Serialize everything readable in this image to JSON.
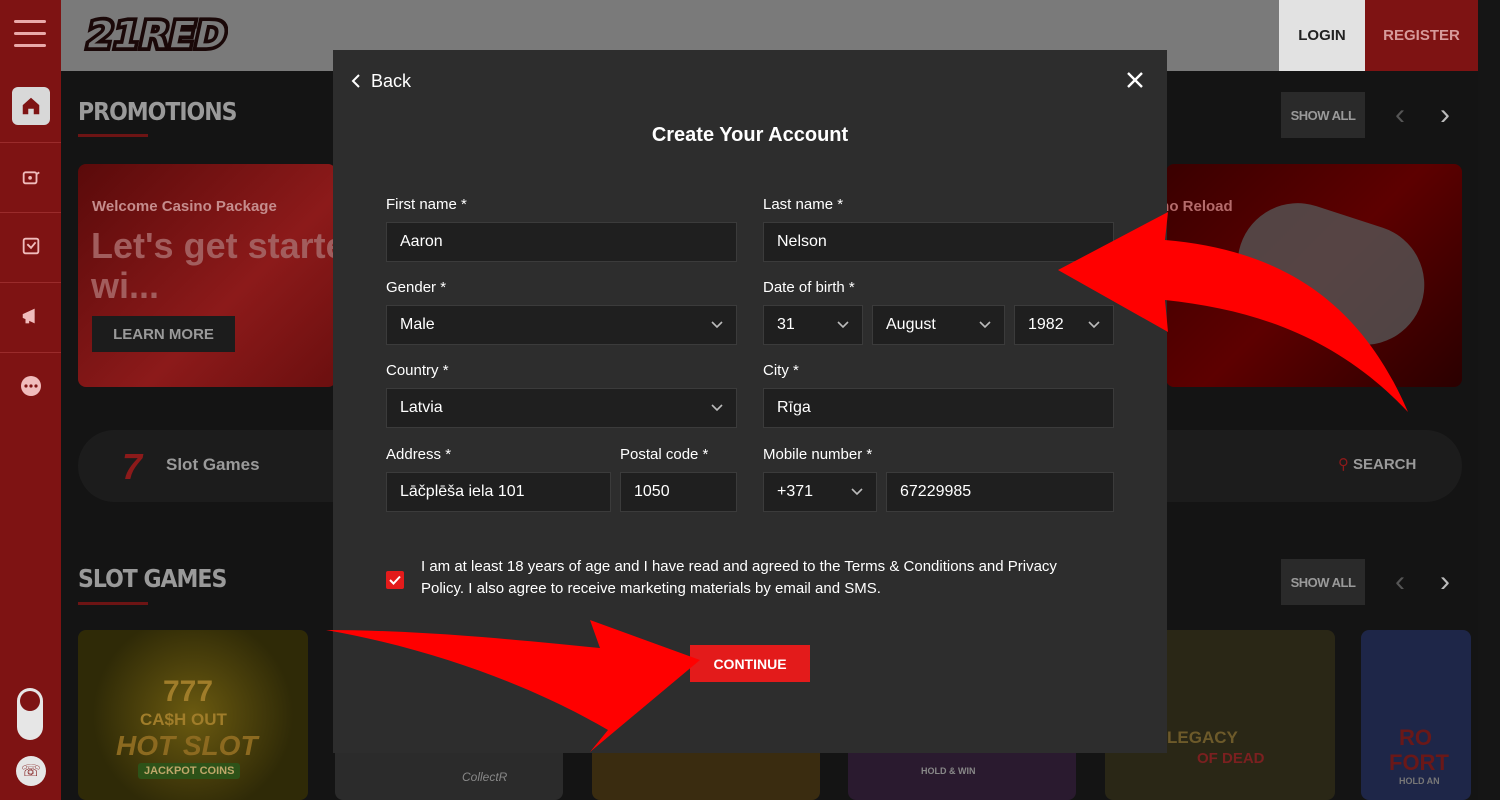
{
  "site": {
    "logo_text": "21RED",
    "login_label": "LOGIN",
    "register_label": "REGISTER"
  },
  "sidebar": {
    "icons": [
      "menu-icon",
      "home-icon",
      "casino-icon",
      "sports-icon",
      "promotions-icon",
      "more-icon",
      "theme-toggle",
      "support-icon"
    ]
  },
  "promotions": {
    "title": "PROMOTIONS",
    "show_all": "SHOW ALL",
    "left_card": {
      "subtitle": "Welcome Casino Package",
      "headline": "Let's get started wi...",
      "button": "LEARN MORE"
    },
    "right_card": {
      "subtitle": "ino Reload"
    }
  },
  "search": {
    "category": "Slot Games",
    "search_label": "SEARCH"
  },
  "slot_games": {
    "title": "SLOT GAMES",
    "show_all": "SHOW ALL",
    "tiles": [
      {
        "line1": "777",
        "line2": "CA$H OUT",
        "line3": "HOT SLOT",
        "line4": "JACKPOT COINS"
      },
      {
        "line1": "CollectR"
      },
      {
        "line1": ""
      },
      {
        "line1": "HOLD & WIN"
      },
      {
        "line1": "LEGACY",
        "line2": "OF DEAD"
      },
      {
        "line1": "RO",
        "line2": "FORT",
        "line3": "HOLD AN"
      }
    ]
  },
  "modal": {
    "back_label": "Back",
    "title": "Create Your Account",
    "fields": {
      "first_name": {
        "label": "First name *",
        "value": "Aaron"
      },
      "last_name": {
        "label": "Last name *",
        "value": "Nelson"
      },
      "gender": {
        "label": "Gender *",
        "value": "Male"
      },
      "dob": {
        "label": "Date of birth *",
        "day": "31",
        "month": "August",
        "year": "1982"
      },
      "country": {
        "label": "Country *",
        "value": "Latvia"
      },
      "city": {
        "label": "City *",
        "value": "Rīga"
      },
      "address": {
        "label": "Address *",
        "value": "Lāčplēša iela 101"
      },
      "postal_code": {
        "label": "Postal code *",
        "value": "1050"
      },
      "mobile": {
        "label": "Mobile number *",
        "prefix": "+371",
        "value": "67229985"
      }
    },
    "consent_text": "I am at least 18 years of age and I have read and agreed to the Terms & Conditions and Privacy Policy. I also agree to receive marketing materials by email and SMS.",
    "consent_checked": true,
    "continue_label": "CONTINUE"
  },
  "colors": {
    "accent_red": "#e31b1b",
    "sidebar_red": "#7e1313",
    "modal_bg": "#2d2d2d",
    "input_bg": "#1f1f1f"
  }
}
